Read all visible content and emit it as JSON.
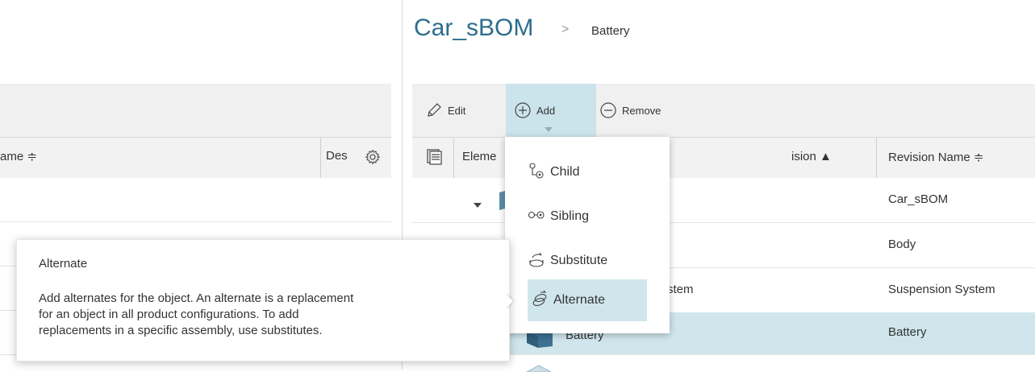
{
  "left_pane": {
    "header": {
      "name_col": "ame ≑",
      "des_col": "Des"
    },
    "gear_icon": "gear-icon"
  },
  "breadcrumb": {
    "title": "Car_sBOM",
    "separator": ">",
    "current": "Battery"
  },
  "toolbar": {
    "edit_label": "Edit",
    "add_label": "Add",
    "remove_label": "Remove"
  },
  "right_table": {
    "columns": {
      "element": "Eleme",
      "revision": "ision ▲",
      "revision_name": "Revision Name ≑"
    },
    "rows": [
      {
        "element": "",
        "revision_name": "Car_sBOM"
      },
      {
        "element": "",
        "revision_name": "Body"
      },
      {
        "element": "stem",
        "revision_name": "Suspension System"
      },
      {
        "element": "Battery",
        "revision_name": "Battery"
      }
    ]
  },
  "add_menu": {
    "items": [
      {
        "label": "Child",
        "icon": "child-icon"
      },
      {
        "label": "Sibling",
        "icon": "sibling-icon"
      },
      {
        "label": "Substitute",
        "icon": "substitute-icon"
      },
      {
        "label": "Alternate",
        "icon": "alternate-icon"
      }
    ]
  },
  "tooltip": {
    "title": "Alternate",
    "body": "Add alternates for the object. An alternate is a replacement\nfor an object in all product configurations. To add\nreplacements in a specific assembly, use substitutes."
  },
  "colors": {
    "accent": "#2c6e8e",
    "selection": "#cfe6ec",
    "toolbar_bg": "#f0f0f0"
  }
}
